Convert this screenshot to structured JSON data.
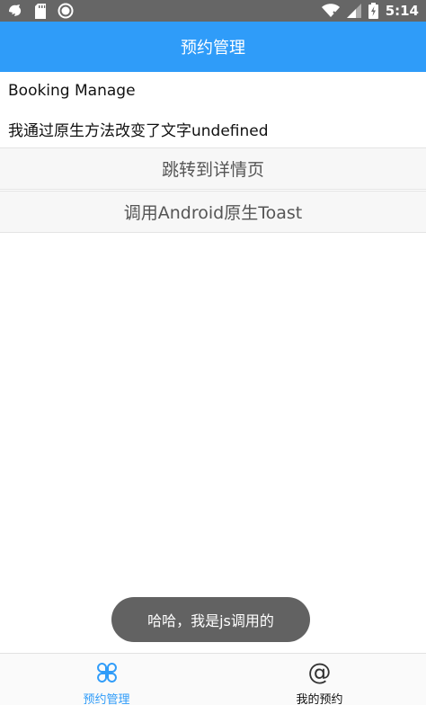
{
  "status_bar": {
    "time": "5:14",
    "icons": [
      "notification-bird-icon",
      "sd-card-icon",
      "record-icon",
      "wifi-icon",
      "signal-icon",
      "battery-icon"
    ]
  },
  "header": {
    "title": "预约管理"
  },
  "main": {
    "line1": "Booking Manage",
    "line2": "我通过原生方法改变了文字undefined",
    "buttons": [
      {
        "label": "跳转到详情页"
      },
      {
        "label": "调用Android原生Toast"
      }
    ]
  },
  "toast": {
    "text": "哈哈，我是js调用的"
  },
  "tabs": [
    {
      "label": "预约管理",
      "icon": "clover-icon",
      "active": true
    },
    {
      "label": "我的预约",
      "icon": "at-icon",
      "active": false
    }
  ],
  "colors": {
    "accent": "#2f9cf9",
    "status_bar": "#666666",
    "toast_bg": "#626262"
  }
}
